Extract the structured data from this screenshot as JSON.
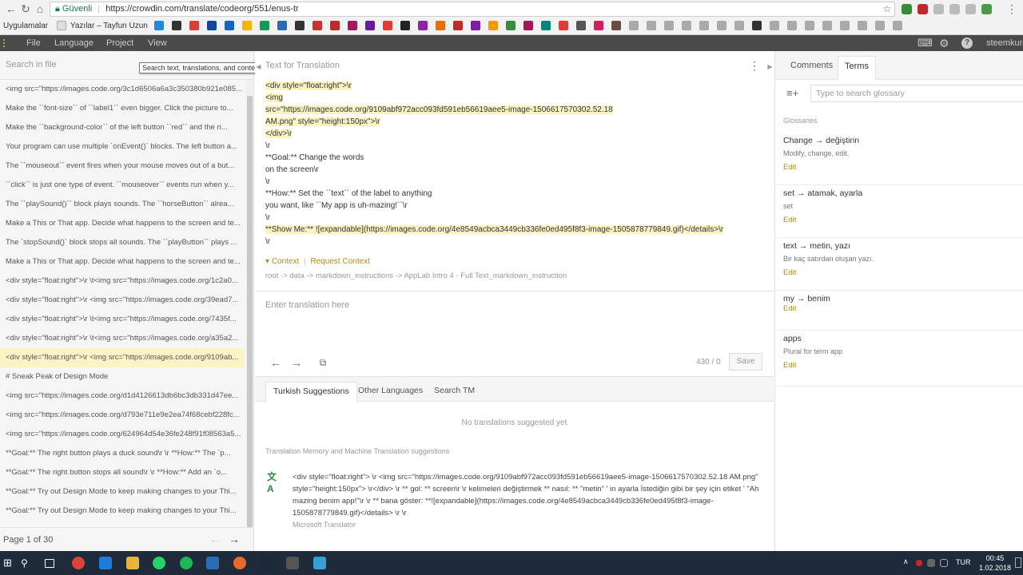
{
  "browser": {
    "security_label": "Güvenli",
    "url": "https://crowdin.com/translate/codeorg/551/enus-tr",
    "bookmarks": [
      "Uygulamalar",
      "Yazılar – Tayfun Uzun"
    ]
  },
  "menubar": {
    "items": [
      "File",
      "Language",
      "Project",
      "View"
    ],
    "user": "steemkurd"
  },
  "left": {
    "search_placeholder": "Search in file",
    "search_tooltip": "Search text, translations, and context",
    "strings": [
      "<img src=\"https://images.code.org/3c1d6506a6a3c350380b921e085...",
      "Make the ``font-size`` of ``label1`` even bigger. Click the picture to...",
      "Make the ``background-color`` of the left button ``red`` and the ri...",
      "Your program can use multiple `onEvent()` blocks. The left button a...",
      "The ``mouseout`` event fires when your mouse moves out of a but...",
      "``click`` is just one type of event. ``mouseover`` events run when y...",
      "The ``playSound()`` block plays sounds. The ``horseButton`` alrea...",
      "Make a This or That app. Decide what happens to the screen and te...",
      "The `stopSound()` block stops all sounds. The ``playButton`` plays ...",
      "Make a This or That app. Decide what happens to the screen and te...",
      "<div style=\"float:right\">\\r \\t<img src=\"https://images.code.org/1c2a0...",
      "<div style=\"float:right\">\\r <img src=\"https://images.code.org/39ead7...",
      "<div style=\"float:right\">\\r \\t<img src=\"https://images.code.org/7435f...",
      "<div style=\"float:right\">\\r \\t<img src=\"https://images.code.org/a35a2...",
      "<div style=\"float:right\">\\r <img src=\"https://images.code.org/9109ab...",
      "# Sneak Peak of Design Mode",
      "<img src=\"https://images.code.org/d1d4126613db6bc3db331d47ee...",
      "<img src=\"https://images.code.org/d793e711e9e2ea74f68cebf228fc...",
      "<img src=\"https://images.code.org/624964d54e36fe248f91f08563a5...",
      "**Goal:** The right button plays a duck sound\\r \\r **How:** The `p...",
      "**Goal:** The right button stops all sound\\r \\r **How:** Add an `o...",
      "**Goal:** Try out Design Mode to keep making changes to your Thi...",
      "**Goal:** Try out Design Mode to keep making changes to your Thi..."
    ],
    "selected_index": 14,
    "pager": "Page 1 of 30"
  },
  "editor": {
    "source_label": "Text for Translation",
    "source_lines": [
      "<div style=\"float:right\">\\r",
      "<img",
      "src=\"https://images.code.org/9109abf972acc093fd591eb56619aee5-image-1506617570302.52.18",
      "AM.png\" style=\"height:150px\">\\r",
      "</div>\\r",
      "\\r",
      "**Goal:** Change the words",
      "on the screen\\r",
      "\\r",
      "**How:** Set the ``text`` of the label to anything",
      "you want, like ``My app is uh-mazing!``\\r",
      "\\r",
      "**Show Me:** ![expandable](https://images.code.org/4e8549acbca3449cb336fe0ed495f8f3-image-1505878779849.gif)</details>\\r",
      "\\r"
    ],
    "context_label": "Context",
    "request_context_label": "Request Context",
    "breadcrumb": "root -> data -> markdown_instructions -> AppLab Intro 4 - Full Text_markdown_instruction",
    "translation_placeholder": "Enter translation here",
    "counter": "430 / 0",
    "save_label": "Save",
    "tabs": [
      "Turkish Suggestions",
      "Other Languages",
      "Search TM"
    ],
    "no_suggestions": "No translations suggested yet",
    "tm_label": "Translation Memory and Machine Translation suggestions",
    "tm_text": "<div style=\"float:right\"> \\r <img src=\"https://images.code.org/9109abf972acc093fd591eb56619aee5-image-1506617570302.52.18 AM.png\" style=\"height:150px\"> \\r</div> \\r ** gol: ** screen\\r \\r kelimeleri değiştirmek ** nasıl: ** \"metin\" ' in ayarla İstediğin gibi bir şey için etiket ' \"Ah mazing benim app!\"\\r \\r ** bana göster: **![expandable](https://images.code.org/4e8549acbca3449cb336fe0ed495f8f3-image-1505878779849.gif)</details> \\r \\r",
    "tm_source": "Microsoft Translator"
  },
  "right": {
    "tabs": [
      "Comments",
      "Terms"
    ],
    "glossary_placeholder": "Type to search glossary",
    "glossaries_label": "Glossaries",
    "terms": [
      {
        "title": "Change → değiştirin",
        "desc": "Modify, change, edit.",
        "edit": "Edit"
      },
      {
        "title": "set → atamak, ayarla",
        "desc": "set",
        "edit": "Edit"
      },
      {
        "title": "text → metin, yazı",
        "desc": "Bir kaç satırdan oluşan yazı.",
        "edit": "Edit"
      },
      {
        "title": "my → benim",
        "desc": "",
        "edit": "Edit"
      },
      {
        "title": "apps",
        "desc": "Plural for term app",
        "edit": "Edit"
      }
    ]
  },
  "taskbar": {
    "language": "TUR",
    "time": "00:45",
    "date": "1.02.2018"
  },
  "colors": {
    "accent": "#b08a1a",
    "highlight": "#fcf3c6",
    "menubar": "#4a4a4a",
    "taskbar": "#1f2a3a"
  }
}
